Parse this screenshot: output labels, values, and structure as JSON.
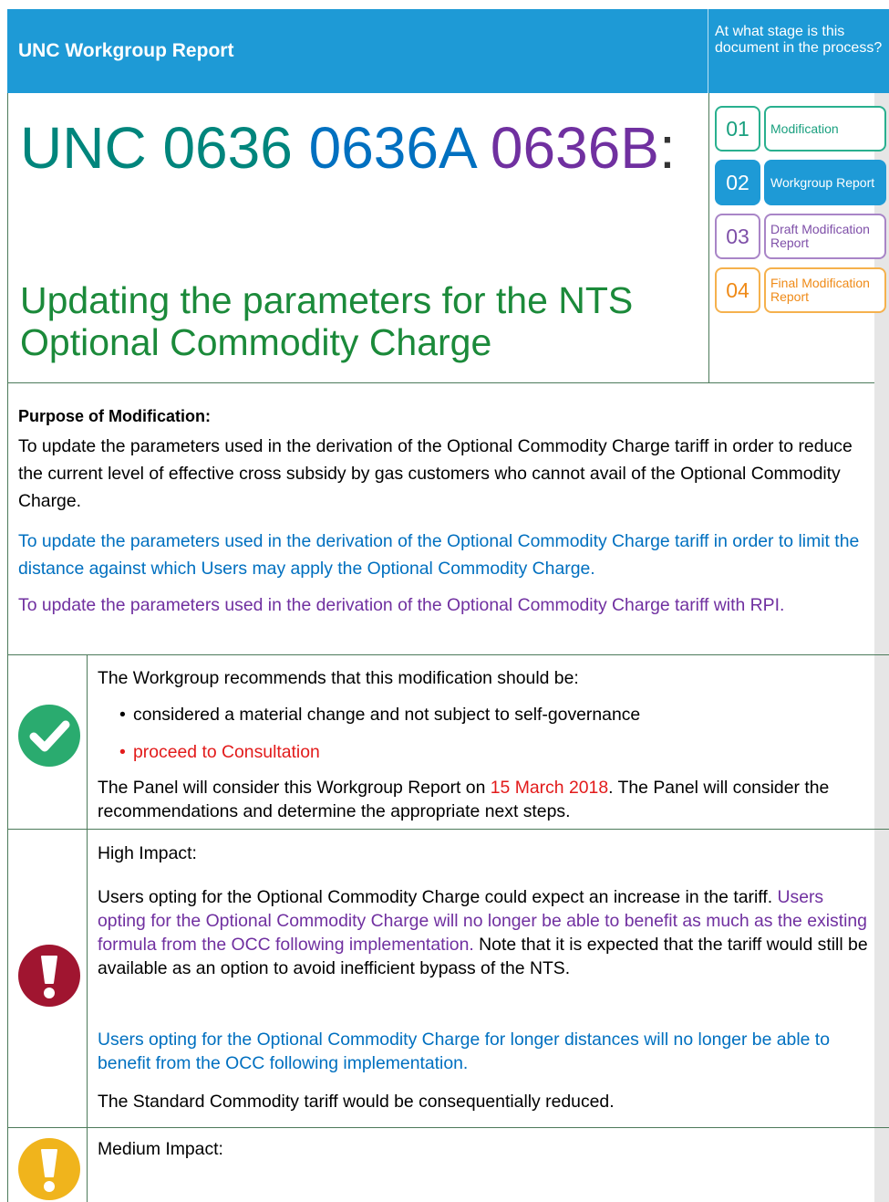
{
  "header": {
    "title": "UNC Workgroup Report",
    "stage_question": "At what stage is this document in the process?"
  },
  "title": {
    "part1": "UNC 0636",
    "part2": "0636A",
    "part3": "0636B",
    "colon": ":",
    "subtitle": "Updating the parameters for the NTS Optional Commodity Charge"
  },
  "stages": [
    {
      "num": "01",
      "label": "Modification"
    },
    {
      "num": "02",
      "label": "Workgroup Report"
    },
    {
      "num": "03",
      "label": "Draft Modification Report"
    },
    {
      "num": "04",
      "label": "Final Modification Report"
    }
  ],
  "purpose": {
    "heading": "Purpose of Modification:",
    "p1": "To update the parameters used in the derivation of the Optional Commodity Charge tariff in order to reduce the current level of effective cross subsidy by gas customers who cannot avail of the Optional Commodity Charge.",
    "p2": "To update the parameters used in the derivation of the Optional Commodity Charge tariff in order to limit the distance against which Users may apply the Optional Commodity Charge.",
    "p3": "To update the parameters used in the derivation of the Optional Commodity Charge tariff with RPI."
  },
  "recommendation": {
    "icon": "check-circle-icon",
    "intro": "The Workgroup recommends that this modification should be:",
    "bullet1": "considered a material change and not subject to self-governance",
    "bullet2": "proceed to Consultation",
    "panel_pre": "The Panel will consider this Workgroup Report on ",
    "panel_date": "15 March 2018",
    "panel_post": ".  The Panel will consider the recommendations and determine the appropriate next steps."
  },
  "high_impact": {
    "icon": "exclamation-circle-icon",
    "heading": "High Impact:",
    "p1_black": "Users opting for the Optional Commodity Charge could expect an increase in the tariff.",
    "p1_purple": " Users opting for the Optional Commodity Charge will no longer be able to benefit as much as the existing formula from the OCC following implementation.",
    "p1_black2": " Note that it is expected that the tariff would still be available as an option to avoid inefficient bypass of the NTS.",
    "p2": "Users opting for the Optional Commodity Charge for longer distances will no longer be able to benefit from the OCC following implementation.",
    "p3": "The Standard Commodity tariff would be consequentially reduced."
  },
  "medium_impact": {
    "icon": "exclamation-circle-icon",
    "heading": "Medium Impact:"
  },
  "colors": {
    "header_blue": "#1e9ad6",
    "teal": "#00857c",
    "blue": "#0070c0",
    "purple": "#7030a0",
    "green": "#1b8a3a",
    "red": "#e21b1b",
    "check_green": "#2aab6f",
    "impact_red": "#a01530",
    "impact_amber": "#f0b41c"
  }
}
